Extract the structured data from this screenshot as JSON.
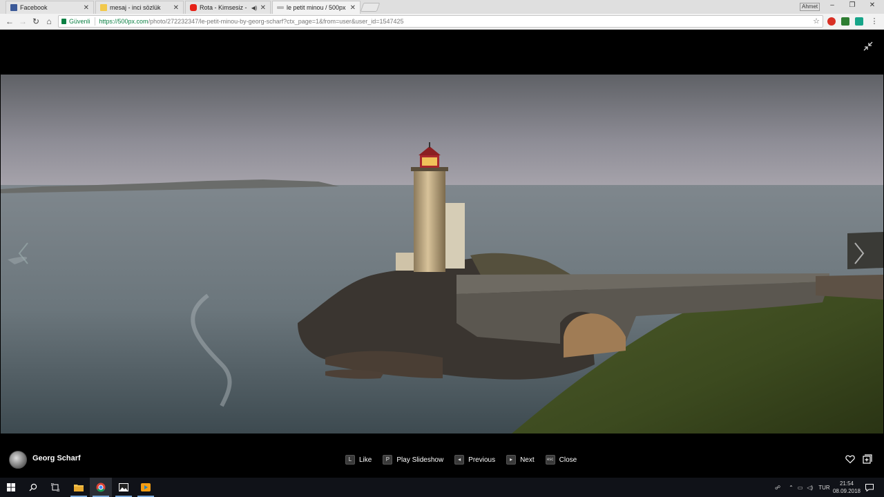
{
  "browser": {
    "tabs": [
      {
        "title": "Facebook",
        "favicon_color": "#3b5998"
      },
      {
        "title": "mesaj - inci sözlük",
        "favicon_color": "#f2c94c"
      },
      {
        "title": "Rota - Kimsesiz - You",
        "favicon_color": "#e62117"
      },
      {
        "title": "le petit minou / 500px",
        "favicon_color": "#aaaaaa"
      }
    ],
    "user_label": "Ahmet",
    "security_label": "Güvenli",
    "url_host": "https://500px.com",
    "url_path": "/photo/272232347/le-petit-minou-by-georg-scharf?ctx_page=1&from=user&user_id=1547425"
  },
  "viewer": {
    "photographer": "Georg Scharf",
    "shortcuts": [
      {
        "key": "L",
        "label": "Like"
      },
      {
        "key": "P",
        "label": "Play Slideshow"
      },
      {
        "key": "◂",
        "label": "Previous"
      },
      {
        "key": "▸",
        "label": "Next"
      },
      {
        "key": "esc",
        "label": "Close"
      }
    ]
  },
  "taskbar": {
    "language": "TUR",
    "time": "21:54",
    "date": "08.09.2018"
  },
  "icons": {
    "back": "back-arrow-icon",
    "forward": "forward-arrow-icon",
    "reload": "reload-icon",
    "home": "home-icon",
    "star": "bookmark-star-icon",
    "menu": "kebab-menu-icon",
    "collapse": "collapse-fullscreen-icon",
    "heart": "heart-icon",
    "add": "add-to-collection-icon"
  }
}
